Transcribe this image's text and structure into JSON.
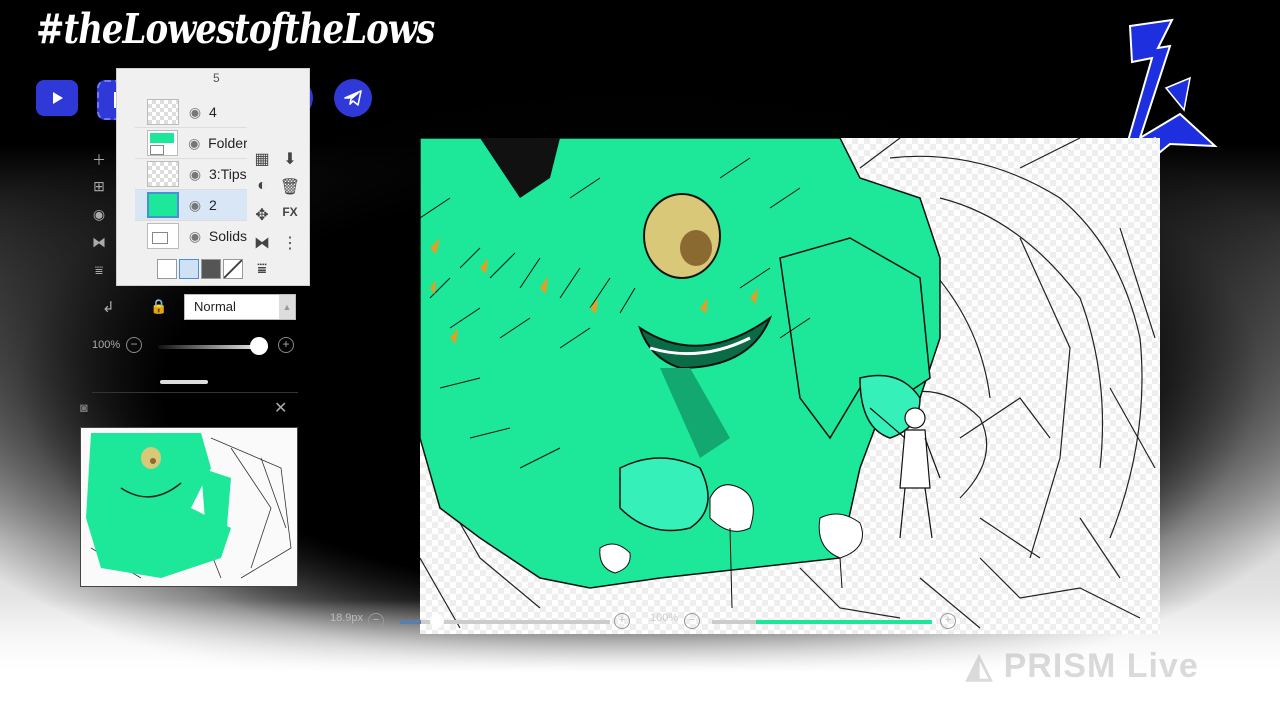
{
  "overlay": {
    "brand_text": "#theLowestoftheLows",
    "socials": [
      {
        "name": "youtube-icon",
        "color": "#2f39d8"
      },
      {
        "name": "kick-icon",
        "color": "#2f39d8"
      },
      {
        "name": "tiktok-icon",
        "color": "#2f39d8"
      },
      {
        "name": "snapchat-icon",
        "color": "#2f39d8"
      },
      {
        "name": "rumble-icon",
        "color": "#2f39d8"
      },
      {
        "name": "telegram-icon",
        "color": "#2f39d8"
      }
    ],
    "brand_mark_text": "L",
    "accent_color": "#1e2fe0",
    "watermark": "PRISM Live"
  },
  "layers_panel": {
    "partial_top_label": "5",
    "partial_second_label": "4",
    "layers": [
      {
        "name": "Folder",
        "type": "folder"
      },
      {
        "name": "3:Tips",
        "type": "layer"
      },
      {
        "name": "2",
        "type": "layer",
        "selected": true
      },
      {
        "name": "Solids",
        "type": "folder"
      }
    ],
    "tool_icons": [
      "checker-icon",
      "download-icon",
      "clip-icon",
      "trash-icon",
      "move-icon",
      "fx-icon",
      "flip-icon",
      "more-icon",
      "merge-down-icon"
    ],
    "blend_mode": "Normal",
    "opacity_label": "100%"
  },
  "navigator": {
    "camera_icon": "camera-icon",
    "close_icon": "close-icon"
  },
  "bottom_bar": {
    "brush_size": "18.9px",
    "zoom_label": "100%"
  },
  "colors": {
    "art_green": "#1de89a",
    "eye_yellow": "#d8c878"
  }
}
